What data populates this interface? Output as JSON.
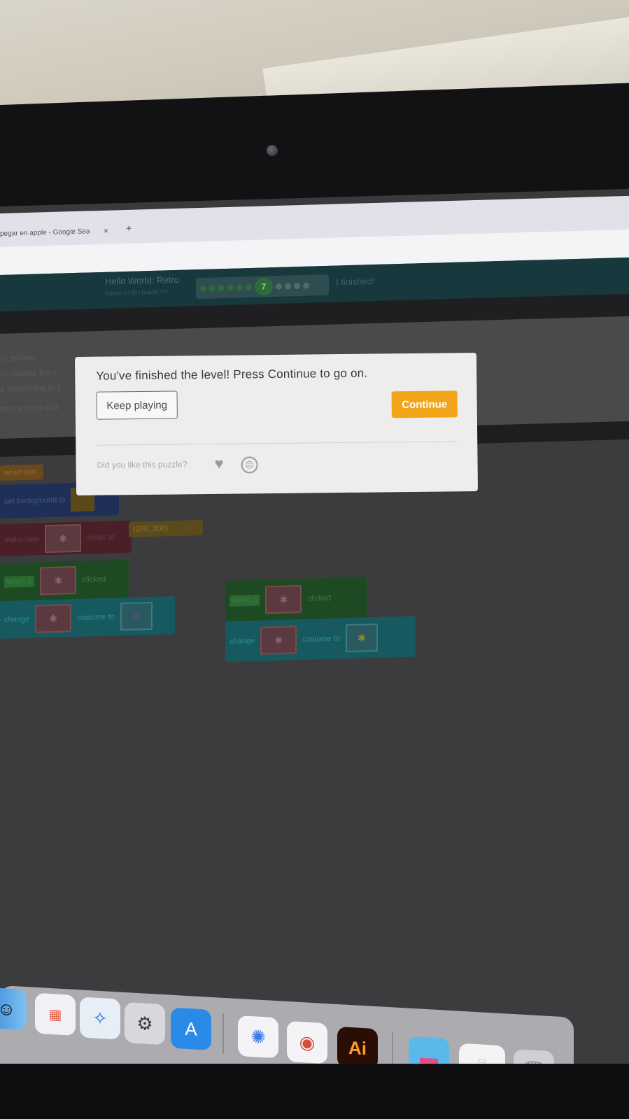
{
  "browser": {
    "tab_title": "pegar en apple - Google Sea",
    "tab_close": "×",
    "new_tab": "+"
  },
  "game_header": {
    "title": "Hello World: Retro",
    "subtitle": "course 1 / 10 / puzzle 7/7",
    "level": "7",
    "finish_link": "I finished!"
  },
  "instructions": {
    "lines": [
      "of sprites.",
      "to change the c",
      "e something to t",
      "stume more tha"
    ]
  },
  "blocks": {
    "orange_label": "when run",
    "set_background": "set background to",
    "make_new": "make new",
    "sprite_at": "sprite at",
    "coords": "(200, 200)",
    "when_a": "when a",
    "clicked": "clicked",
    "change": "change",
    "costume_to": "costume to"
  },
  "dialog": {
    "message": "You've finished the level! Press Continue to go on.",
    "keep_playing": "Keep playing",
    "continue": "Continue",
    "feedback_question": "Did you like this puzzle?",
    "continue_color": "#f2a418"
  },
  "dock": {
    "icons": [
      "finder-icon",
      "launchpad-icon",
      "safari-icon",
      "system-preferences-icon",
      "app-store-icon",
      "asterisk-app-icon",
      "chrome-icon",
      "illustrator-icon",
      "folder-icon",
      "document-icon",
      "trash-icon"
    ],
    "illustrator_label": "Ai"
  }
}
